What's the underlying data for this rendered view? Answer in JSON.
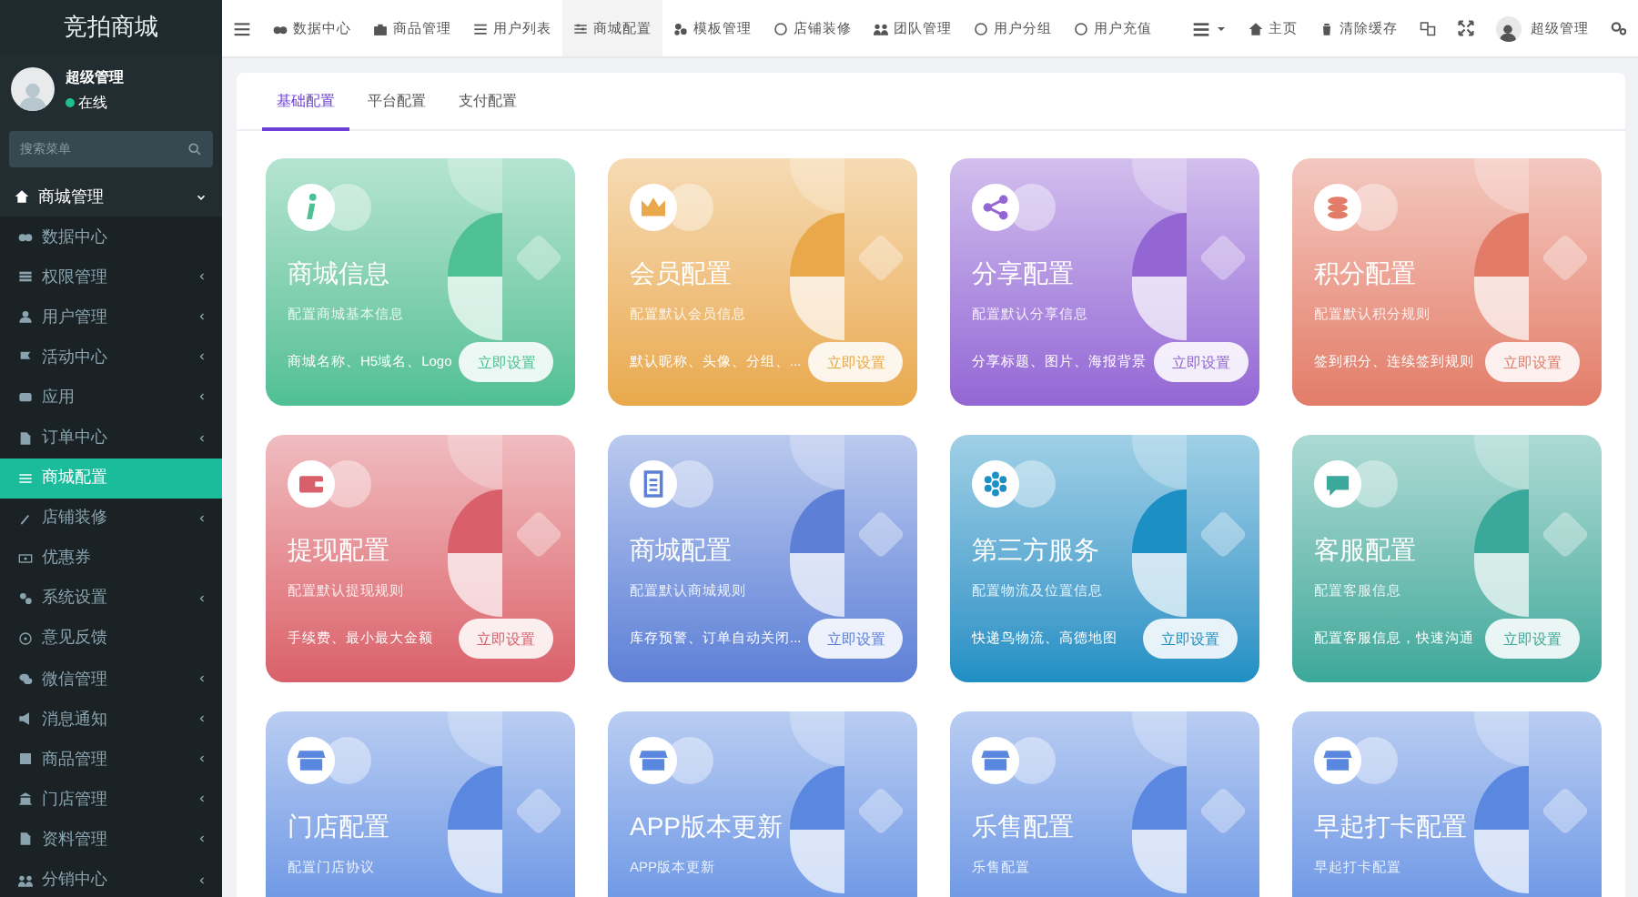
{
  "sidebar": {
    "title": "竞拍商城",
    "user": {
      "name": "超级管理",
      "status": "在线"
    },
    "search": {
      "placeholder": "搜索菜单"
    },
    "group": {
      "label": "商城管理",
      "expanded": true,
      "items": [
        {
          "label": "数据中心",
          "selected": false,
          "has_submenu": false
        },
        {
          "label": "权限管理",
          "selected": false,
          "has_submenu": true
        },
        {
          "label": "用户管理",
          "selected": false,
          "has_submenu": true
        },
        {
          "label": "活动中心",
          "selected": false,
          "has_submenu": true
        },
        {
          "label": "应用",
          "selected": false,
          "has_submenu": true
        },
        {
          "label": "订单中心",
          "selected": false,
          "has_submenu": true
        },
        {
          "label": "商城配置",
          "selected": true,
          "has_submenu": false
        },
        {
          "label": "店铺装修",
          "selected": false,
          "has_submenu": true
        },
        {
          "label": "优惠券",
          "selected": false,
          "has_submenu": false
        },
        {
          "label": "系统设置",
          "selected": false,
          "has_submenu": true
        },
        {
          "label": "意见反馈",
          "selected": false,
          "has_submenu": false
        },
        {
          "label": "微信管理",
          "selected": false,
          "has_submenu": true
        },
        {
          "label": "消息通知",
          "selected": false,
          "has_submenu": true
        },
        {
          "label": "商品管理",
          "selected": false,
          "has_submenu": true
        },
        {
          "label": "门店管理",
          "selected": false,
          "has_submenu": true
        },
        {
          "label": "资料管理",
          "selected": false,
          "has_submenu": true
        },
        {
          "label": "分销中心",
          "selected": false,
          "has_submenu": true
        }
      ]
    }
  },
  "top_nav": {
    "items": [
      {
        "label": "数据中心",
        "selected": false
      },
      {
        "label": "商品管理",
        "selected": false
      },
      {
        "label": "用户列表",
        "selected": false
      },
      {
        "label": "商城配置",
        "selected": true
      },
      {
        "label": "模板管理",
        "selected": false
      },
      {
        "label": "店铺装修",
        "selected": false
      },
      {
        "label": "团队管理",
        "selected": false
      },
      {
        "label": "用户分组",
        "selected": false
      },
      {
        "label": "用户充值",
        "selected": false
      }
    ],
    "home": "主页",
    "clear_cache": "清除缓存",
    "user": "超级管理"
  },
  "tabs": [
    {
      "label": "基础配置",
      "selected": true
    },
    {
      "label": "平台配置",
      "selected": false
    },
    {
      "label": "支付配置",
      "selected": false
    }
  ],
  "cards": [
    {
      "title": "商城信息",
      "subtitle": "配置商城基本信息",
      "detail": "商城名称、H5域名、Logo",
      "button": "立即设置",
      "color": "#4fbf94"
    },
    {
      "title": "会员配置",
      "subtitle": "配置默认会员信息",
      "detail": "默认昵称、头像、分组、...",
      "button": "立即设置",
      "color": "#e9a94b"
    },
    {
      "title": "分享配置",
      "subtitle": "配置默认分享信息",
      "detail": "分享标题、图片、海报背景",
      "button": "立即设置",
      "color": "#9466d4"
    },
    {
      "title": "积分配置",
      "subtitle": "配置默认积分规则",
      "detail": "签到积分、连续签到规则",
      "button": "立即设置",
      "color": "#e27c68"
    },
    {
      "title": "提现配置",
      "subtitle": "配置默认提现规则",
      "detail": "手续费、最小最大金额",
      "button": "立即设置",
      "color": "#d9606a"
    },
    {
      "title": "商城配置",
      "subtitle": "配置默认商城规则",
      "detail": "库存预警、订单自动关闭...",
      "button": "立即设置",
      "color": "#5d7fd6"
    },
    {
      "title": "第三方服务",
      "subtitle": "配置物流及位置信息",
      "detail": "快递鸟物流、高德地图",
      "button": "立即设置",
      "color": "#1c8fc4"
    },
    {
      "title": "客服配置",
      "subtitle": "配置客服信息",
      "detail": "配置客服信息，快速沟通",
      "button": "立即设置",
      "color": "#3aa89a"
    },
    {
      "title": "门店配置",
      "subtitle": "配置门店协议",
      "color": "#5a88e0"
    },
    {
      "title": "APP版本更新",
      "subtitle": "APP版本更新",
      "color": "#5a88e0"
    },
    {
      "title": "乐售配置",
      "subtitle": "乐售配置",
      "color": "#5a88e0"
    },
    {
      "title": "早起打卡配置",
      "subtitle": "早起打卡配置",
      "color": "#5a88e0"
    }
  ]
}
